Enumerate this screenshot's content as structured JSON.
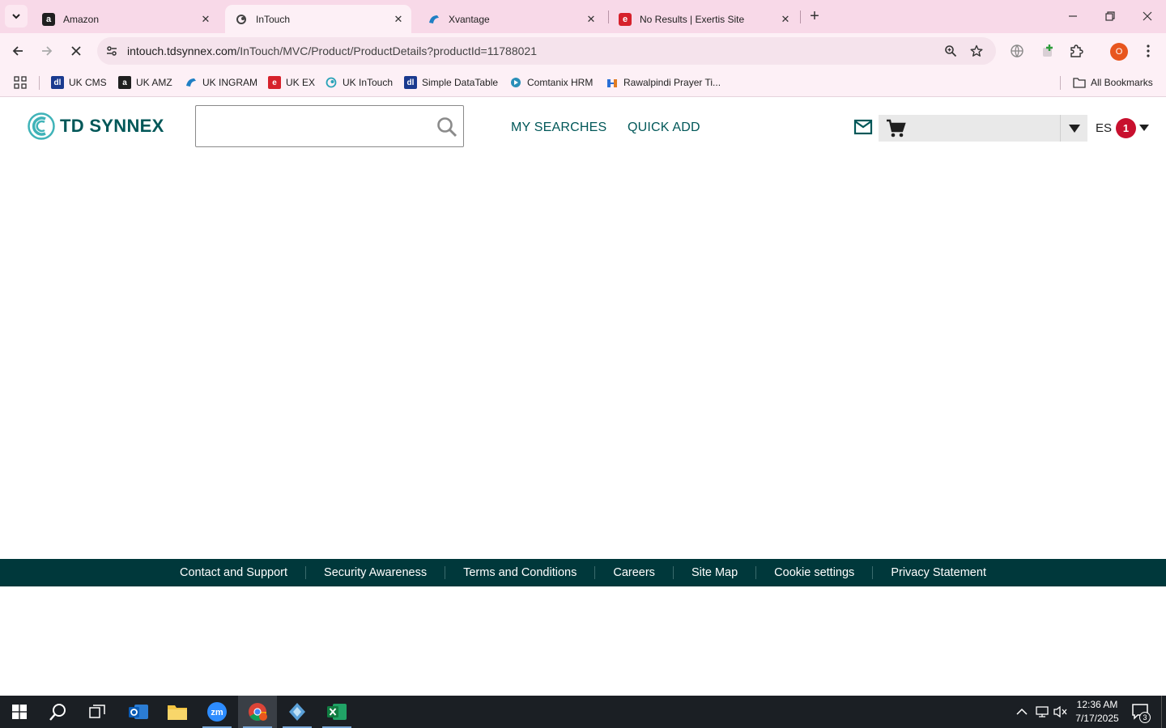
{
  "browser": {
    "tabs": [
      {
        "title": "Amazon",
        "favicon": "amazon-icon",
        "active": false
      },
      {
        "title": "InTouch",
        "favicon": "intouch-icon",
        "active": true
      },
      {
        "title": "Xvantage",
        "favicon": "xvantage-icon",
        "active": false
      },
      {
        "title": "No Results | Exertis Site",
        "favicon": "exertis-icon",
        "active": false
      }
    ],
    "url_host": "intouch.tdsynnex.com",
    "url_path": "/InTouch/MVC/Product/ProductDetails?productId=11788021",
    "profile_initial": "O",
    "bookmarks": [
      {
        "label": "UK CMS",
        "icon": "cms-icon"
      },
      {
        "label": "UK AMZ",
        "icon": "amazon-icon"
      },
      {
        "label": "UK INGRAM",
        "icon": "ingram-icon"
      },
      {
        "label": "UK EX",
        "icon": "exertis-icon"
      },
      {
        "label": "UK InTouch",
        "icon": "intouch-icon"
      },
      {
        "label": "Simple DataTable",
        "icon": "datatable-icon"
      },
      {
        "label": "Comtanix HRM",
        "icon": "hrm-icon"
      },
      {
        "label": "Rawalpindi Prayer Ti...",
        "icon": "prayer-icon"
      }
    ],
    "all_bookmarks": "All Bookmarks"
  },
  "site": {
    "logo_text": "TD SYNNEX",
    "search_placeholder": "",
    "nav": {
      "my_searches": "MY SEARCHES",
      "quick_add": "QUICK ADD"
    },
    "user_initials": "ES",
    "notification_count": "1",
    "brand_color": "#005758"
  },
  "footer": {
    "links": [
      "Contact and Support",
      "Security Awareness",
      "Terms and Conditions",
      "Careers",
      "Site Map",
      "Cookie settings",
      "Privacy Statement"
    ],
    "background": "#00383b"
  },
  "taskbar": {
    "time": "12:36 AM",
    "date": "7/17/2025",
    "notification_count": "3"
  }
}
